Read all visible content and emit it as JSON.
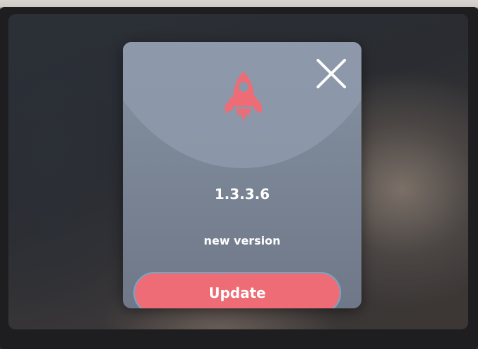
{
  "dialog": {
    "version": "1.3.3.6",
    "subtitle": "new version",
    "update_label": "Update",
    "close_icon": "close-icon",
    "rocket_icon": "rocket-icon"
  },
  "colors": {
    "accent": "#ee6c76",
    "dialog_bg": "#7c8797",
    "button_border": "#6fa9c8",
    "text": "#ffffff"
  }
}
